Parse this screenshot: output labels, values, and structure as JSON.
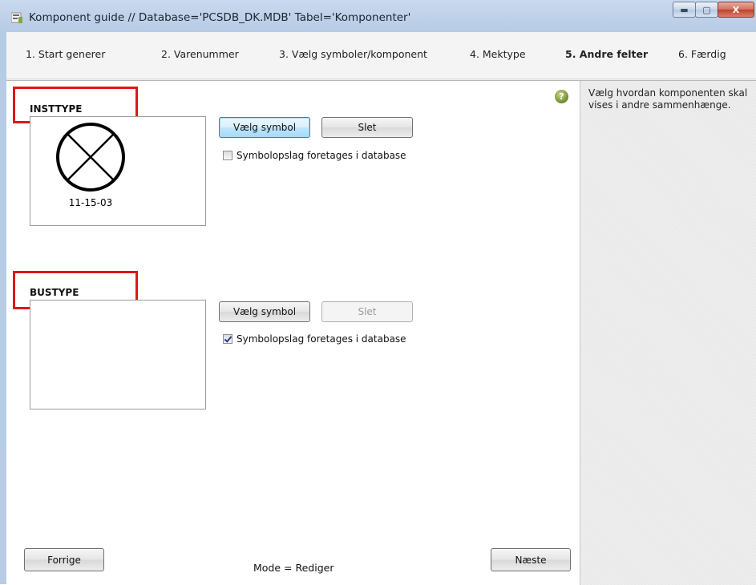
{
  "window": {
    "title": "Komponent guide  //  Database='PCSDB_DK.MDB' Tabel='Komponenter'",
    "minimize_glyph": "▬",
    "maximize_glyph": "▢",
    "close_glyph": "X"
  },
  "steps": [
    {
      "label": "1. Start generer"
    },
    {
      "label": "2. Varenummer"
    },
    {
      "label": "3. Vælg symboler/komponent"
    },
    {
      "label": "4. Mektype"
    },
    {
      "label": "5. Andre felter",
      "active": true
    },
    {
      "label": "6. Færdig"
    }
  ],
  "help_glyph": "?",
  "insttype": {
    "label": "INSTTYPE",
    "symbol_code": "11-15-03",
    "symbol_icon": "circle-cross-icon",
    "choose_label": "Vælg symbol",
    "delete_label": "Slet",
    "checkbox_label": "Symbolopslag foretages i database",
    "checkbox_checked": false
  },
  "bustype": {
    "label": "BUSTYPE",
    "choose_label": "Vælg symbol",
    "delete_label": "Slet",
    "checkbox_label": "Symbolopslag foretages i database",
    "checkbox_checked": true
  },
  "sidebar": {
    "text": "Vælg hvordan komponenten skal vises i andre sammenhænge."
  },
  "footer": {
    "prev_label": "Forrige",
    "next_label": "Næste",
    "mode_text": "Mode = Rediger"
  },
  "colors": {
    "highlight_red": "#e0161b",
    "focus_blue": "#3c7fb1"
  }
}
